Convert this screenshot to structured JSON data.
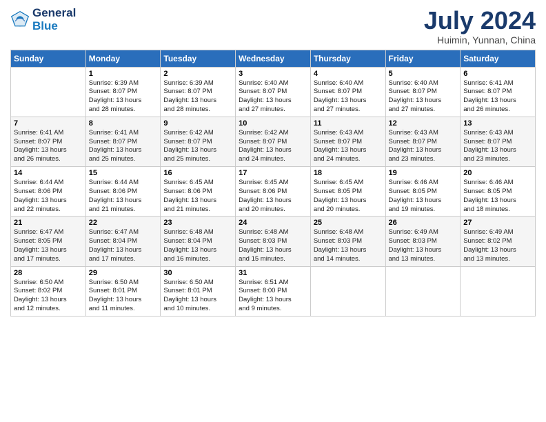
{
  "logo": {
    "line1": "General",
    "line2": "Blue"
  },
  "title": "July 2024",
  "subtitle": "Huimin, Yunnan, China",
  "header_days": [
    "Sunday",
    "Monday",
    "Tuesday",
    "Wednesday",
    "Thursday",
    "Friday",
    "Saturday"
  ],
  "weeks": [
    [
      {
        "day": "",
        "content": ""
      },
      {
        "day": "1",
        "content": "Sunrise: 6:39 AM\nSunset: 8:07 PM\nDaylight: 13 hours\nand 28 minutes."
      },
      {
        "day": "2",
        "content": "Sunrise: 6:39 AM\nSunset: 8:07 PM\nDaylight: 13 hours\nand 28 minutes."
      },
      {
        "day": "3",
        "content": "Sunrise: 6:40 AM\nSunset: 8:07 PM\nDaylight: 13 hours\nand 27 minutes."
      },
      {
        "day": "4",
        "content": "Sunrise: 6:40 AM\nSunset: 8:07 PM\nDaylight: 13 hours\nand 27 minutes."
      },
      {
        "day": "5",
        "content": "Sunrise: 6:40 AM\nSunset: 8:07 PM\nDaylight: 13 hours\nand 27 minutes."
      },
      {
        "day": "6",
        "content": "Sunrise: 6:41 AM\nSunset: 8:07 PM\nDaylight: 13 hours\nand 26 minutes."
      }
    ],
    [
      {
        "day": "7",
        "content": "Sunrise: 6:41 AM\nSunset: 8:07 PM\nDaylight: 13 hours\nand 26 minutes."
      },
      {
        "day": "8",
        "content": "Sunrise: 6:41 AM\nSunset: 8:07 PM\nDaylight: 13 hours\nand 25 minutes."
      },
      {
        "day": "9",
        "content": "Sunrise: 6:42 AM\nSunset: 8:07 PM\nDaylight: 13 hours\nand 25 minutes."
      },
      {
        "day": "10",
        "content": "Sunrise: 6:42 AM\nSunset: 8:07 PM\nDaylight: 13 hours\nand 24 minutes."
      },
      {
        "day": "11",
        "content": "Sunrise: 6:43 AM\nSunset: 8:07 PM\nDaylight: 13 hours\nand 24 minutes."
      },
      {
        "day": "12",
        "content": "Sunrise: 6:43 AM\nSunset: 8:07 PM\nDaylight: 13 hours\nand 23 minutes."
      },
      {
        "day": "13",
        "content": "Sunrise: 6:43 AM\nSunset: 8:07 PM\nDaylight: 13 hours\nand 23 minutes."
      }
    ],
    [
      {
        "day": "14",
        "content": "Sunrise: 6:44 AM\nSunset: 8:06 PM\nDaylight: 13 hours\nand 22 minutes."
      },
      {
        "day": "15",
        "content": "Sunrise: 6:44 AM\nSunset: 8:06 PM\nDaylight: 13 hours\nand 21 minutes."
      },
      {
        "day": "16",
        "content": "Sunrise: 6:45 AM\nSunset: 8:06 PM\nDaylight: 13 hours\nand 21 minutes."
      },
      {
        "day": "17",
        "content": "Sunrise: 6:45 AM\nSunset: 8:06 PM\nDaylight: 13 hours\nand 20 minutes."
      },
      {
        "day": "18",
        "content": "Sunrise: 6:45 AM\nSunset: 8:05 PM\nDaylight: 13 hours\nand 20 minutes."
      },
      {
        "day": "19",
        "content": "Sunrise: 6:46 AM\nSunset: 8:05 PM\nDaylight: 13 hours\nand 19 minutes."
      },
      {
        "day": "20",
        "content": "Sunrise: 6:46 AM\nSunset: 8:05 PM\nDaylight: 13 hours\nand 18 minutes."
      }
    ],
    [
      {
        "day": "21",
        "content": "Sunrise: 6:47 AM\nSunset: 8:05 PM\nDaylight: 13 hours\nand 17 minutes."
      },
      {
        "day": "22",
        "content": "Sunrise: 6:47 AM\nSunset: 8:04 PM\nDaylight: 13 hours\nand 17 minutes."
      },
      {
        "day": "23",
        "content": "Sunrise: 6:48 AM\nSunset: 8:04 PM\nDaylight: 13 hours\nand 16 minutes."
      },
      {
        "day": "24",
        "content": "Sunrise: 6:48 AM\nSunset: 8:03 PM\nDaylight: 13 hours\nand 15 minutes."
      },
      {
        "day": "25",
        "content": "Sunrise: 6:48 AM\nSunset: 8:03 PM\nDaylight: 13 hours\nand 14 minutes."
      },
      {
        "day": "26",
        "content": "Sunrise: 6:49 AM\nSunset: 8:03 PM\nDaylight: 13 hours\nand 13 minutes."
      },
      {
        "day": "27",
        "content": "Sunrise: 6:49 AM\nSunset: 8:02 PM\nDaylight: 13 hours\nand 13 minutes."
      }
    ],
    [
      {
        "day": "28",
        "content": "Sunrise: 6:50 AM\nSunset: 8:02 PM\nDaylight: 13 hours\nand 12 minutes."
      },
      {
        "day": "29",
        "content": "Sunrise: 6:50 AM\nSunset: 8:01 PM\nDaylight: 13 hours\nand 11 minutes."
      },
      {
        "day": "30",
        "content": "Sunrise: 6:50 AM\nSunset: 8:01 PM\nDaylight: 13 hours\nand 10 minutes."
      },
      {
        "day": "31",
        "content": "Sunrise: 6:51 AM\nSunset: 8:00 PM\nDaylight: 13 hours\nand 9 minutes."
      },
      {
        "day": "",
        "content": ""
      },
      {
        "day": "",
        "content": ""
      },
      {
        "day": "",
        "content": ""
      }
    ]
  ]
}
